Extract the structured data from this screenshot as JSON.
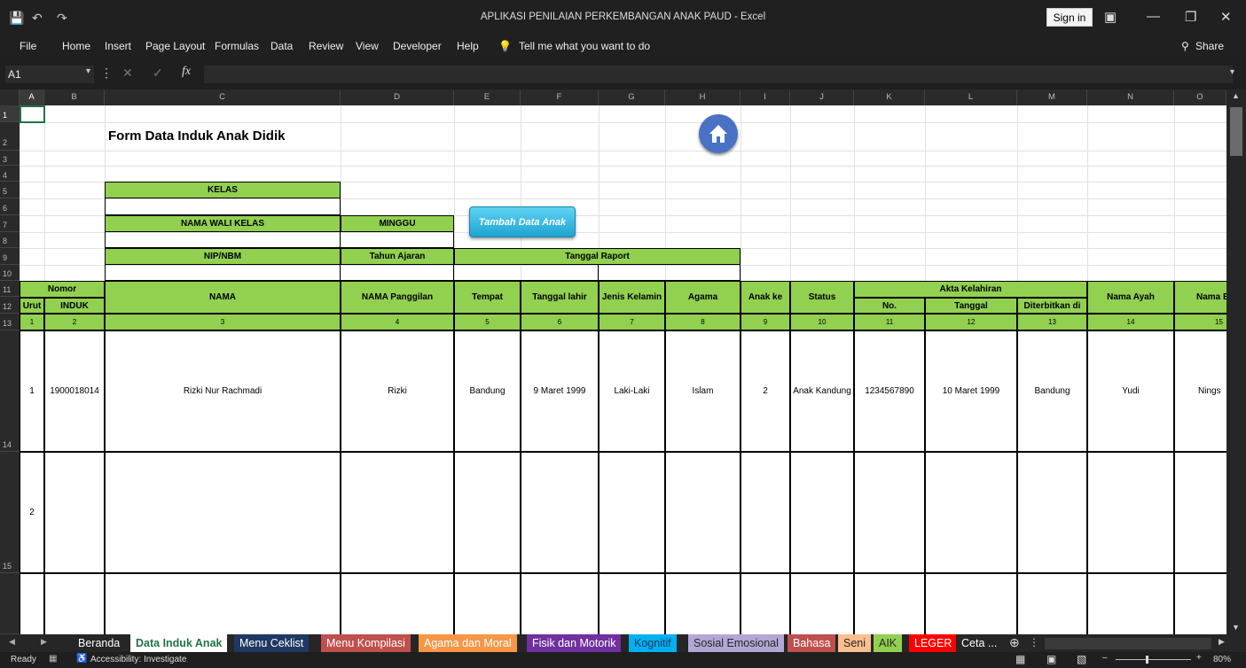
{
  "window": {
    "title": "APLIKASI PENILAIAN PERKEMBANGAN ANAK PAUD  -  Excel",
    "sign_in": "Sign in",
    "share": "Share"
  },
  "menu": [
    "File",
    "Home",
    "Insert",
    "Page Layout",
    "Formulas",
    "Data",
    "Review",
    "View",
    "Developer",
    "Help"
  ],
  "tell_me": "Tell me what you want to do",
  "name_box": "A1",
  "columns": [
    "A",
    "B",
    "C",
    "D",
    "E",
    "F",
    "G",
    "H",
    "I",
    "J",
    "K",
    "L",
    "M",
    "N",
    "O"
  ],
  "rows": [
    "1",
    "2",
    "3",
    "4",
    "5",
    "6",
    "7",
    "8",
    "9",
    "10",
    "11",
    "12",
    "13",
    "14",
    "15",
    "3"
  ],
  "form": {
    "title": "Form Data Induk Anak Didik",
    "kelas": "KELAS",
    "nama_wali": "NAMA WALI KELAS",
    "minggu": "MINGGU",
    "nip": "NIP/NBM",
    "tahun_ajaran": "Tahun Ajaran",
    "tanggal_raport": "Tanggal Raport",
    "button": "Tambah Data Anak"
  },
  "table": {
    "nomor": "Nomor",
    "urut": "Urut",
    "induk": "INDUK",
    "headers": [
      "NAMA",
      "NAMA Panggilan",
      "Tempat",
      "Tanggal lahir",
      "Jenis Kelamin",
      "Agama",
      "Anak ke",
      "Status"
    ],
    "akta": "Akta Kelahiran",
    "akta_sub": [
      "No.",
      "Tanggal",
      "Diterbitkan di"
    ],
    "nama_ayah": "Nama Ayah",
    "nama_ibu": "Nama Bu",
    "numbers": [
      "1",
      "2",
      "3",
      "4",
      "5",
      "6",
      "7",
      "8",
      "9",
      "10",
      "11",
      "12",
      "13",
      "14",
      "15"
    ],
    "row1": [
      "1",
      "1900018014",
      "Rizki Nur Rachmadi",
      "Rizki",
      "Bandung",
      "9 Maret 1999",
      "Laki-Laki",
      "Islam",
      "2",
      "Anak Kandung",
      "1234567890",
      "10 Maret 1999",
      "Bandung",
      "Yudi",
      "Nings"
    ],
    "row2_no": "2"
  },
  "sheets": [
    {
      "name": "Beranda",
      "bg": "#262626",
      "fg": "#ffffff"
    },
    {
      "name": "Data Induk Anak",
      "bg": "#ffffff",
      "fg": "#217346"
    },
    {
      "name": "Menu Ceklist",
      "bg": "#1f3864",
      "fg": "#ffffff"
    },
    {
      "name": "Menu Kompilasi",
      "bg": "#c0504d",
      "fg": "#ffffff"
    },
    {
      "name": "Agama dan Moral",
      "bg": "#f79646",
      "fg": "#ffffff"
    },
    {
      "name": "Fisik dan Motorik",
      "bg": "#7030a0",
      "fg": "#ffffff"
    },
    {
      "name": "Kognitif",
      "bg": "#00b0f0",
      "fg": "#1f3864"
    },
    {
      "name": "Sosial Emosional",
      "bg": "#b4a7d6",
      "fg": "#262626"
    },
    {
      "name": "Bahasa",
      "bg": "#c0504d",
      "fg": "#ffffff"
    },
    {
      "name": "Seni",
      "bg": "#fabf8f",
      "fg": "#262626"
    },
    {
      "name": "AIK",
      "bg": "#92d050",
      "fg": "#262626"
    },
    {
      "name": "LEGER",
      "bg": "#ff0000",
      "fg": "#ffffff"
    },
    {
      "name": "Ceta ...",
      "bg": "#262626",
      "fg": "#ffffff"
    }
  ],
  "status": {
    "ready": "Ready",
    "accessibility": "Accessibility: Investigate",
    "zoom": "80%"
  }
}
